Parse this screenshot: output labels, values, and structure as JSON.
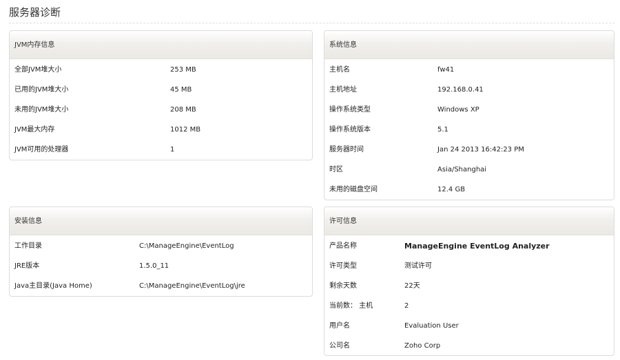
{
  "page": {
    "title": "服务器诊断"
  },
  "jvm": {
    "header": "JVM内存信息",
    "rows": [
      {
        "label": "全部JVM堆大小",
        "value": "253 MB"
      },
      {
        "label": "已用的JVM堆大小",
        "value": "45 MB"
      },
      {
        "label": "未用的JVM堆大小",
        "value": "208 MB"
      },
      {
        "label": "JVM最大内存",
        "value": "1012 MB"
      },
      {
        "label": "JVM可用的处理器",
        "value": "1"
      }
    ]
  },
  "system": {
    "header": "系统信息",
    "rows": [
      {
        "label": "主机名",
        "value": "fw41"
      },
      {
        "label": "主机地址",
        "value": "192.168.0.41"
      },
      {
        "label": "操作系统类型",
        "value": "Windows XP"
      },
      {
        "label": "操作系统版本",
        "value": "5.1"
      },
      {
        "label": "服务器时间",
        "value": "Jan 24 2013 16:42:23 PM"
      },
      {
        "label": "时区",
        "value": "Asia/Shanghai"
      },
      {
        "label": "未用的磁盘空间",
        "value": "12.4 GB"
      }
    ]
  },
  "install": {
    "header": "安装信息",
    "rows": [
      {
        "label": "工作目录",
        "value": "C:\\ManageEngine\\EventLog"
      },
      {
        "label": "JRE版本",
        "value": "1.5.0_11"
      },
      {
        "label": "Java主目录(Java Home)",
        "value": "C:\\ManageEngine\\EventLog\\jre"
      }
    ]
  },
  "license": {
    "header": "许可信息",
    "rows": [
      {
        "label": "产品名称",
        "value": "ManageEngine EventLog Analyzer"
      },
      {
        "label": "许可类型",
        "value": "测试许可"
      },
      {
        "label": "剩余天数",
        "value": "22天"
      },
      {
        "label": "当前数： 主机",
        "value": "2"
      },
      {
        "label": "用户名",
        "value": "Evaluation User"
      },
      {
        "label": "公司名",
        "value": "Zoho Corp"
      }
    ]
  }
}
